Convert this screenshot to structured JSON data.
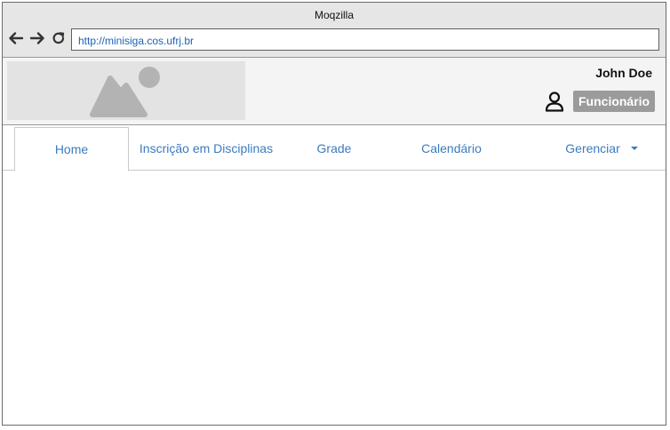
{
  "browser": {
    "window_title": "Moqzilla",
    "url": "http://minisiga.cos.ufrj.br",
    "buttons": {
      "back": "back-arrow-icon",
      "forward": "forward-arrow-icon",
      "reload": "reload-icon"
    }
  },
  "header": {
    "logo_icon": "image-placeholder-icon",
    "user_name": "John Doe",
    "user_icon": "user-icon",
    "role": "Funcionário"
  },
  "tabs": [
    {
      "label": "Home",
      "active": true
    },
    {
      "label": "Inscrição em Disciplinas",
      "active": false
    },
    {
      "label": "Grade",
      "active": false
    },
    {
      "label": "Calendário",
      "active": false
    },
    {
      "label": "Gerenciar",
      "active": false,
      "dropdown": true
    }
  ],
  "colors": {
    "link": "#3b7bbf",
    "url_text": "#1a62b8",
    "badge_bg": "#9b9b9b"
  }
}
